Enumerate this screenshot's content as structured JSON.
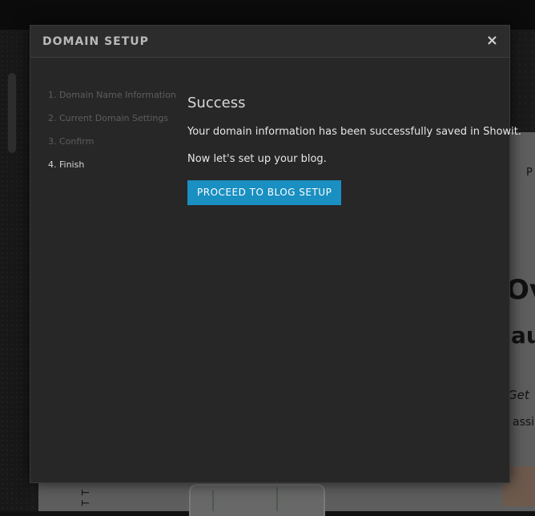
{
  "modal": {
    "title": "DOMAIN SETUP",
    "close_symbol": "×",
    "steps": [
      {
        "label": "1. Domain Name Information",
        "state": "inactive"
      },
      {
        "label": "2. Current Domain Settings",
        "state": "inactive"
      },
      {
        "label": "3. Confirm",
        "state": "inactive"
      },
      {
        "label": "4. Finish",
        "state": "active"
      }
    ],
    "content": {
      "heading": "Success",
      "message": "Your domain information has been successfully saved in Showit.",
      "next_step": "Now let's set up your blog.",
      "button_label": "PROCEED TO BLOG SETUP"
    }
  },
  "background_preview": {
    "text_fragments": [
      "P",
      "Ov",
      "au",
      "Get",
      "assi"
    ],
    "vertical_text": "TT"
  },
  "colors": {
    "modal_bg": "#272727",
    "accent_button": "#1a8fc1",
    "inactive_step": "#5e5e5e",
    "active_step": "#d6d6d6"
  }
}
